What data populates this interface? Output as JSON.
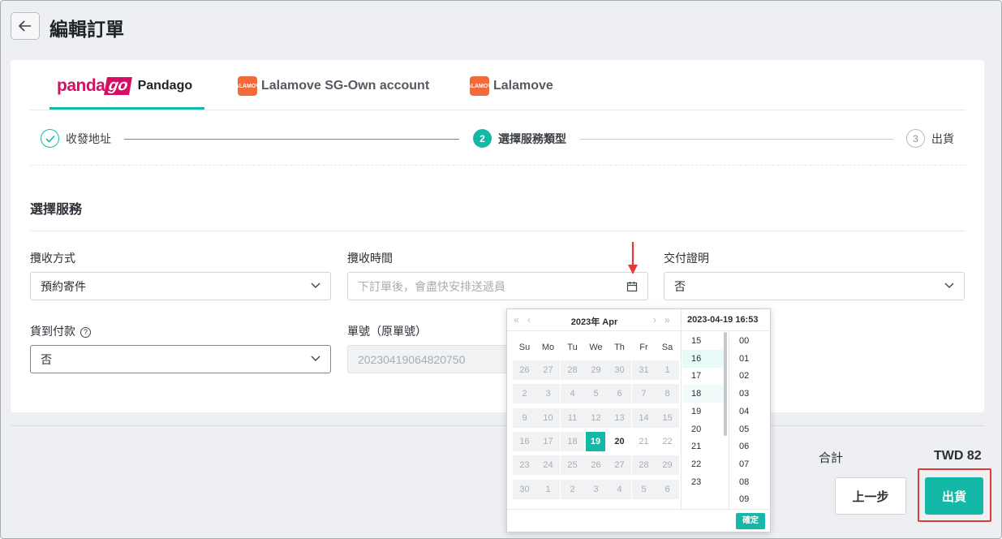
{
  "header": {
    "title": "編輯訂單"
  },
  "tabs": [
    {
      "logo_text_a": "panda",
      "logo_text_b": "go",
      "label": "Pandago"
    },
    {
      "logo_text": "LALAMOVE",
      "label": "Lalamove SG-Own account"
    },
    {
      "logo_text": "LALAMOVE",
      "label": "Lalamove"
    }
  ],
  "steps": [
    {
      "label": "收發地址"
    },
    {
      "num": "2",
      "label": "選擇服務類型"
    },
    {
      "num": "3",
      "label": "出貨"
    }
  ],
  "section": {
    "title": "選擇服務"
  },
  "form": {
    "pickup_method": {
      "label": "攬收方式",
      "value": "預約寄件"
    },
    "pickup_time": {
      "label": "攬收時間",
      "placeholder": "下訂單後，會盡快安排送遞員"
    },
    "delivery_proof": {
      "label": "交付證明",
      "value": "否"
    },
    "cod": {
      "label": "貨到付款",
      "value": "否"
    },
    "order_no": {
      "label": "單號（原單號）",
      "value": "20230419064820750"
    }
  },
  "datepicker": {
    "title": "2023年  Apr",
    "nav_prev_year": "«",
    "nav_prev_month": "‹",
    "nav_next_month": "›",
    "nav_next_year": "»",
    "weekdays": [
      "Su",
      "Mo",
      "Tu",
      "We",
      "Th",
      "Fr",
      "Sa"
    ],
    "weeks": [
      [
        "26",
        "27",
        "28",
        "29",
        "30",
        "31",
        "1"
      ],
      [
        "2",
        "3",
        "4",
        "5",
        "6",
        "7",
        "8"
      ],
      [
        "9",
        "10",
        "11",
        "12",
        "13",
        "14",
        "15"
      ],
      [
        "16",
        "17",
        "18",
        "19",
        "20",
        "21",
        "22"
      ],
      [
        "23",
        "24",
        "25",
        "26",
        "27",
        "28",
        "29"
      ],
      [
        "30",
        "1",
        "2",
        "3",
        "4",
        "5",
        "6"
      ]
    ],
    "selected_day": "19",
    "time_display": "2023-04-19 16:53",
    "hours": [
      "15",
      "16",
      "17",
      "18",
      "19",
      "20",
      "21",
      "22",
      "23"
    ],
    "minutes": [
      "00",
      "01",
      "02",
      "03",
      "04",
      "05",
      "06",
      "07",
      "08",
      "09"
    ],
    "confirm_label": "確定"
  },
  "footer": {
    "total_label": "合計",
    "total_value": "TWD 82",
    "prev_label": "上一步",
    "ship_label": "出貨"
  },
  "colors": {
    "accent": "#14b8a6",
    "highlight": "#e53935",
    "pandago": "#d70f64",
    "lalamove": "#f2693a"
  }
}
